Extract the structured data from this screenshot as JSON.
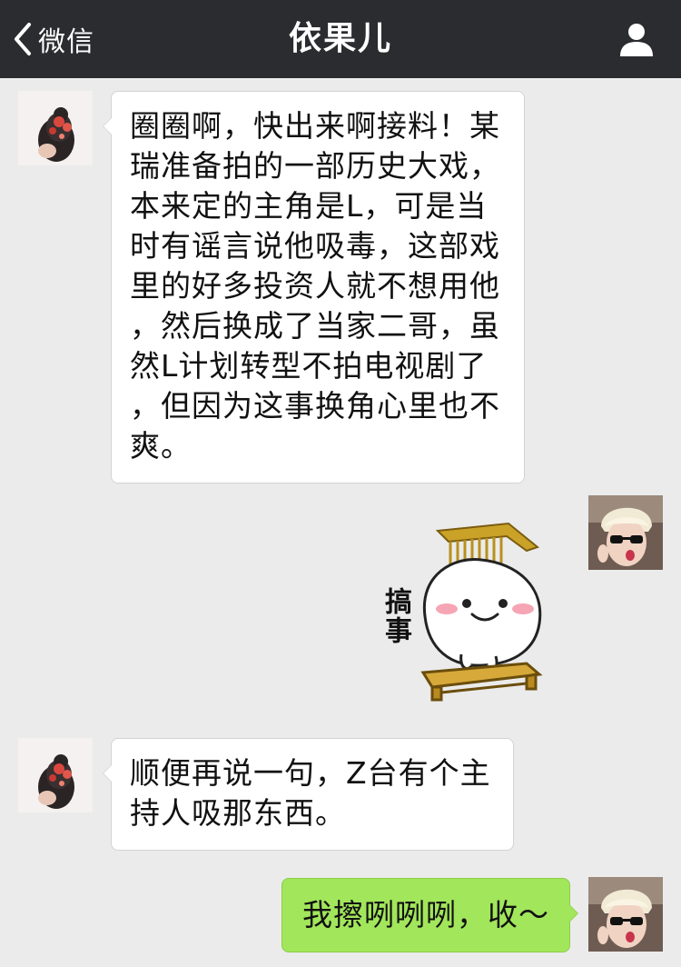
{
  "navbar": {
    "back_label": "微信",
    "title": "依果儿",
    "back_icon": "chevron-left-icon",
    "profile_icon": "person-icon"
  },
  "colors": {
    "navbar_bg": "#2b2c30",
    "chat_bg": "#ebebeb",
    "incoming_bubble": "#ffffff",
    "outgoing_bubble": "#a2e65b"
  },
  "messages": [
    {
      "sender": "contact",
      "type": "text",
      "text": "圈圈啊，快出来啊接料！某\n瑞准备拍的一部历史大戏，\n本来定的主角是L，可是当\n时有谣言说他吸毒，这部戏\n里的好多投资人就不想用他\n，然后换成了当家二哥，虽\n然L计划转型不拍电视剧了\n，但因为这事换角心里也不\n爽。"
    },
    {
      "sender": "me",
      "type": "sticker",
      "sticker_caption": "搞事"
    },
    {
      "sender": "contact",
      "type": "text",
      "text": "顺便再说一句，Z台有个主\n持人吸那东西。"
    },
    {
      "sender": "me",
      "type": "text",
      "text": "我擦咧咧咧，收～"
    }
  ]
}
